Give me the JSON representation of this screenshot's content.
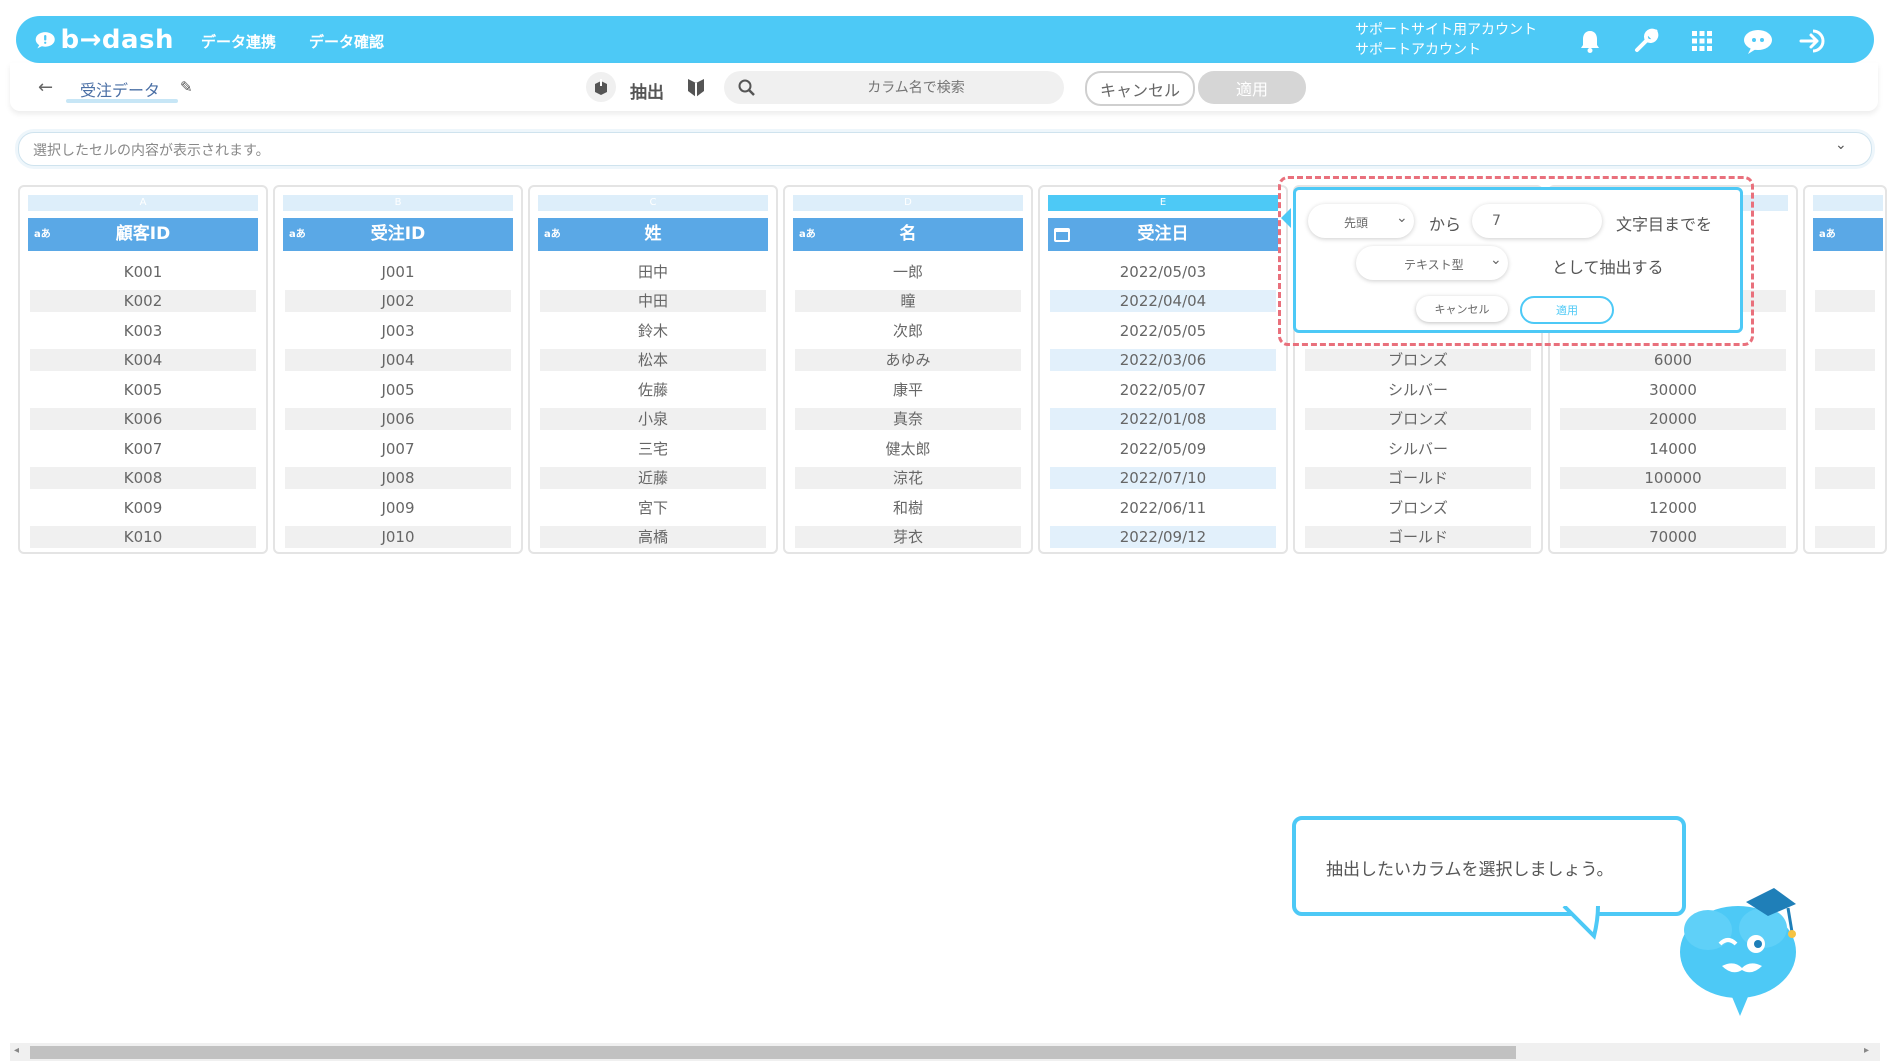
{
  "header": {
    "logo_text": "b→dash",
    "nav": [
      "データ連携",
      "データ確認"
    ],
    "account_line1": "サポートサイト用アカウント",
    "account_line2": "サポートアカウント",
    "icons": [
      "bell-icon",
      "wrench-icon",
      "grid-icon",
      "chat-icon",
      "logout-icon"
    ]
  },
  "subheader": {
    "back_icon": "back-arrow-icon",
    "title": "受注データ",
    "edit_icon": "pencil-icon",
    "mode_label": "抽出",
    "search_placeholder": "カラム名で検索",
    "cancel_label": "キャンセル",
    "apply_label": "適用"
  },
  "cell_bar": {
    "placeholder": "選択したセルの内容が表示されます。"
  },
  "columns": [
    {
      "letter": "A",
      "type": "aあ",
      "name": "顧客ID",
      "values": [
        "K001",
        "K002",
        "K003",
        "K004",
        "K005",
        "K006",
        "K007",
        "K008",
        "K009",
        "K010"
      ]
    },
    {
      "letter": "B",
      "type": "aあ",
      "name": "受注ID",
      "values": [
        "J001",
        "J002",
        "J003",
        "J004",
        "J005",
        "J006",
        "J007",
        "J008",
        "J009",
        "J010"
      ]
    },
    {
      "letter": "C",
      "type": "aあ",
      "name": "姓",
      "values": [
        "田中",
        "中田",
        "鈴木",
        "松本",
        "佐藤",
        "小泉",
        "三宅",
        "近藤",
        "宮下",
        "高橋"
      ]
    },
    {
      "letter": "D",
      "type": "aあ",
      "name": "名",
      "values": [
        "一郎",
        "瞳",
        "次郎",
        "あゆみ",
        "康平",
        "真奈",
        "健太郎",
        "涼花",
        "和樹",
        "芽衣"
      ]
    },
    {
      "letter": "E",
      "type": "calendar",
      "name": "受注日",
      "values": [
        "2022/05/03",
        "2022/04/04",
        "2022/05/05",
        "2022/03/06",
        "2022/05/07",
        "2022/01/08",
        "2022/05/09",
        "2022/07/10",
        "2022/06/11",
        "2022/09/12"
      ]
    },
    {
      "letter": "",
      "type": "",
      "name": "",
      "values": [
        "",
        "",
        "",
        "ブロンズ",
        "シルバー",
        "ブロンズ",
        "シルバー",
        "ゴールド",
        "ブロンズ",
        "ゴールド"
      ]
    },
    {
      "letter": "",
      "type": "",
      "name": "",
      "values": [
        "",
        "",
        "",
        "6000",
        "30000",
        "20000",
        "14000",
        "100000",
        "12000",
        "70000"
      ]
    },
    {
      "letter": "",
      "type": "aあ",
      "name": "",
      "values": [
        "",
        "",
        "",
        "",
        "",
        "",
        "",
        "",
        "",
        ""
      ]
    }
  ],
  "popup": {
    "position_select": "先頭",
    "from_text": "から",
    "count_value": "7",
    "until_text": "文字目までを",
    "type_select": "テキスト型",
    "extract_text": "として抽出する",
    "cancel_label": "キャンセル",
    "apply_label": "適用"
  },
  "bubble": {
    "text": "抽出したいカラムを選択しましょう。"
  }
}
